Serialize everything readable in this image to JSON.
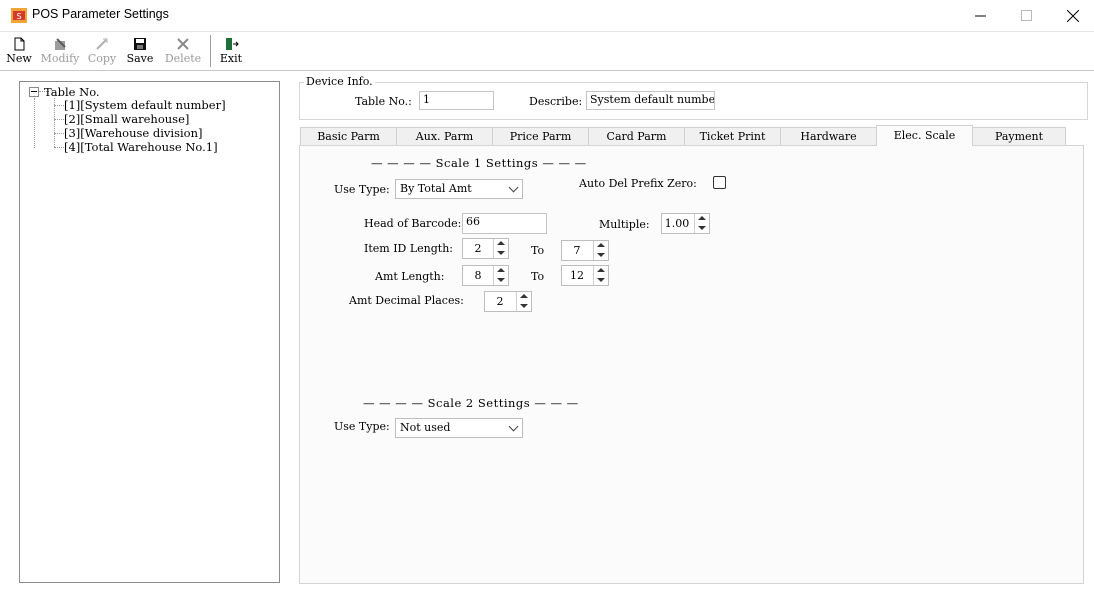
{
  "window": {
    "title": "POS Parameter Settings",
    "controls": {
      "minimize": "minimize-icon",
      "maximize": "maximize-icon",
      "close": "close-icon"
    }
  },
  "toolbar": {
    "new": "New",
    "modify": "Modify",
    "copy": "Copy",
    "save": "Save",
    "delete": "Delete",
    "exit": "Exit"
  },
  "tree": {
    "root": "Table No.",
    "items": [
      "[1][System default number]",
      "[2][Small warehouse]",
      "[3][Warehouse division]",
      "[4][Total Warehouse No.1]"
    ]
  },
  "device": {
    "legend": "Device Info.",
    "table_no_label": "Table No.:",
    "table_no_value": "1",
    "describe_label": "Describe:",
    "describe_value": "System default number"
  },
  "tabs": [
    "Basic Parm",
    "Aux. Parm",
    "Price Parm",
    "Card Parm",
    "Ticket Print",
    "Hardware",
    "Elec. Scale",
    "Payment"
  ],
  "active_tab": "Elec. Scale",
  "scale1": {
    "heading": "— — — — Scale 1 Settings — — —",
    "use_type_label": "Use Type:",
    "use_type_value": "By Total Amt",
    "auto_del_label": "Auto Del Prefix Zero:",
    "auto_del_checked": false,
    "head_label": "Head of Barcode:",
    "head_value": "66",
    "multiple_label": "Multiple:",
    "multiple_value": "1.00",
    "item_id_label": "Item ID Length:",
    "item_id_from": "2",
    "item_id_to_label": "To",
    "item_id_to": "7",
    "amt_len_label": "Amt Length:",
    "amt_len_from": "8",
    "amt_len_to_label": "To",
    "amt_len_to": "12",
    "decimal_label": "Amt Decimal Places:",
    "decimal_value": "2"
  },
  "scale2": {
    "heading": "— — — —  Scale 2 Settings — — —",
    "use_type_label": "Use Type:",
    "use_type_value": "Not used"
  }
}
